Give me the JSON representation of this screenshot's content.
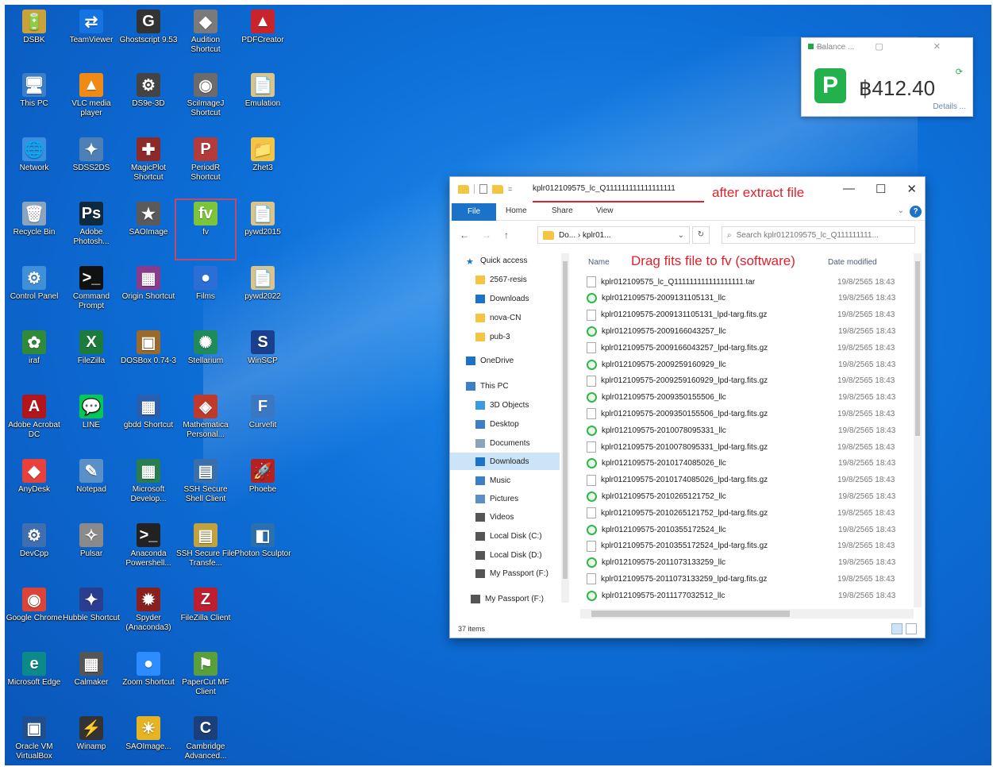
{
  "desktop": {
    "icons": [
      {
        "label": "DSBK",
        "glyph": "🔋",
        "color": "#caa23b"
      },
      {
        "label": "TeamViewer",
        "glyph": "⇄",
        "color": "#1674e2"
      },
      {
        "label": "Ghostscript 9.53",
        "glyph": "G",
        "color": "#333333"
      },
      {
        "label": "Audition Shortcut",
        "glyph": "◆",
        "color": "#7a7a7a"
      },
      {
        "label": "PDFCreator",
        "glyph": "▲",
        "color": "#c9232b"
      },
      {
        "label": "This PC",
        "glyph": "🖥",
        "color": "#3c7ec8"
      },
      {
        "label": "VLC media player",
        "glyph": "▲",
        "color": "#f08a16"
      },
      {
        "label": "DS9e-3D",
        "glyph": "⚙",
        "color": "#444444"
      },
      {
        "label": "SciImageJ Shortcut",
        "glyph": "◉",
        "color": "#6b6b6b"
      },
      {
        "label": "Emulation",
        "glyph": "📄",
        "color": "#d9c48c"
      },
      {
        "label": "Network",
        "glyph": "🌐",
        "color": "#3a8fe0"
      },
      {
        "label": "SDSS2DS",
        "glyph": "✦",
        "color": "#4e7fb6"
      },
      {
        "label": "MagicPlot Shortcut",
        "glyph": "✚",
        "color": "#8c2a2a"
      },
      {
        "label": "PeriodR Shortcut",
        "glyph": "P",
        "color": "#b33b3b"
      },
      {
        "label": "Zhet3",
        "glyph": "📁",
        "color": "#f4c542"
      },
      {
        "label": "Recycle Bin",
        "glyph": "🗑",
        "color": "#8aa4c0"
      },
      {
        "label": "Adobe Photosh...",
        "glyph": "Ps",
        "color": "#0f2a3f"
      },
      {
        "label": "SAOImage",
        "glyph": "★",
        "color": "#5a5a5a"
      },
      {
        "label": "fv",
        "glyph": "fv",
        "color": "#7cc43a"
      },
      {
        "label": "pywd2015",
        "glyph": "📄",
        "color": "#d9c48c"
      },
      {
        "label": "Control Panel",
        "glyph": "⚙",
        "color": "#3f8fd9"
      },
      {
        "label": "Command Prompt",
        "glyph": ">_",
        "color": "#111111"
      },
      {
        "label": "Origin Shortcut",
        "glyph": "▦",
        "color": "#8a3b8a"
      },
      {
        "label": "Films",
        "glyph": "●",
        "color": "#2b6fd6"
      },
      {
        "label": "pywd2022",
        "glyph": "📄",
        "color": "#d9c48c"
      },
      {
        "label": "iraf",
        "glyph": "✿",
        "color": "#2f8a3a"
      },
      {
        "label": "FileZilla",
        "glyph": "X",
        "color": "#1c7b3a"
      },
      {
        "label": "DOSBox 0.74-3",
        "glyph": "▣",
        "color": "#9b6a2a"
      },
      {
        "label": "Stellarium",
        "glyph": "✺",
        "color": "#1f8a5a"
      },
      {
        "label": "WinSCP",
        "glyph": "S",
        "color": "#1a3f8f"
      },
      {
        "label": "Adobe Acrobat DC",
        "glyph": "A",
        "color": "#b3151c"
      },
      {
        "label": "LINE",
        "glyph": "💬",
        "color": "#06c755"
      },
      {
        "label": "gbdd Shortcut",
        "glyph": "▦",
        "color": "#2a5fb0"
      },
      {
        "label": "Mathematica Personal...",
        "glyph": "◈",
        "color": "#c0392b"
      },
      {
        "label": "Curvefit",
        "glyph": "F",
        "color": "#3b78c4"
      },
      {
        "label": "AnyDesk",
        "glyph": "◆",
        "color": "#e8413c"
      },
      {
        "label": "Notepad",
        "glyph": "✎",
        "color": "#5a8fc8"
      },
      {
        "label": "Microsoft Develop...",
        "glyph": "▦",
        "color": "#2a7d4f"
      },
      {
        "label": "SSH Secure Shell Client",
        "glyph": "▤",
        "color": "#3a6fae"
      },
      {
        "label": "Phoebe",
        "glyph": "🚀",
        "color": "#b22222"
      },
      {
        "label": "DevCpp",
        "glyph": "⚙",
        "color": "#3f6fb0"
      },
      {
        "label": "Pulsar",
        "glyph": "✧",
        "color": "#8a8a8a"
      },
      {
        "label": "Anaconda Powershell...",
        "glyph": ">_",
        "color": "#222222"
      },
      {
        "label": "SSH Secure File Transfe...",
        "glyph": "▤",
        "color": "#c4a23b"
      },
      {
        "label": "Photon Sculptor",
        "glyph": "◧",
        "color": "#2a6fb0"
      },
      {
        "label": "Google Chrome",
        "glyph": "◉",
        "color": "#db4437"
      },
      {
        "label": "Hubble Shortcut",
        "glyph": "✦",
        "color": "#2b3d8f"
      },
      {
        "label": "Spyder (Anaconda3)",
        "glyph": "✹",
        "color": "#8a1f1f"
      },
      {
        "label": "FileZilla Client",
        "glyph": "Z",
        "color": "#bf1e2e"
      },
      {
        "label": "",
        "glyph": "",
        "color": "transparent"
      },
      {
        "label": "Microsoft Edge",
        "glyph": "e",
        "color": "#0c8a8a"
      },
      {
        "label": "Calmaker",
        "glyph": "▦",
        "color": "#555555"
      },
      {
        "label": "Zoom Shortcut",
        "glyph": "●",
        "color": "#2d8cff"
      },
      {
        "label": "PaperCut MF Client",
        "glyph": "⚑",
        "color": "#5aa03a"
      },
      {
        "label": "",
        "glyph": "",
        "color": "transparent"
      },
      {
        "label": "Oracle VM VirtualBox",
        "glyph": "▣",
        "color": "#1f4f8f"
      },
      {
        "label": "Winamp",
        "glyph": "⚡",
        "color": "#333333"
      },
      {
        "label": "SAOImage...",
        "glyph": "☀",
        "color": "#e6b422"
      },
      {
        "label": "Cambridge Advanced...",
        "glyph": "C",
        "color": "#1a3f7a"
      },
      {
        "label": "",
        "glyph": "",
        "color": "transparent"
      }
    ]
  },
  "balance_widget": {
    "title": "Balance ...",
    "controls": "— ▢ ✕",
    "amount": "฿412.40",
    "details": "Details ...",
    "sync": "⟳"
  },
  "explorer": {
    "title_path": "kplr012109575_lc_Q111111111111111111",
    "annotation_title": "after extract file",
    "win_min": "—",
    "win_max": "☐",
    "win_close": "✕",
    "tabs": {
      "file": "File",
      "home": "Home",
      "share": "Share",
      "view": "View"
    },
    "help": "?",
    "address": "Do... › kplr01...",
    "address_dropdown": "⌄",
    "refresh": "↻",
    "search_placeholder": "Search kplr012109575_lc_Q111111111...",
    "nav_back": "←",
    "nav_forward": "→",
    "nav_up": "↑",
    "nav_items": [
      {
        "label": "Quick access",
        "icon": "star",
        "color": "#1a73c8"
      },
      {
        "label": "2567-resis",
        "icon": "folder",
        "color": "#f4c542"
      },
      {
        "label": "Downloads",
        "icon": "download",
        "color": "#1a73c8"
      },
      {
        "label": "nova-CN",
        "icon": "folder",
        "color": "#f4c542"
      },
      {
        "label": "pub-3",
        "icon": "folder",
        "color": "#f4c542"
      },
      {
        "label": "OneDrive",
        "icon": "cloud",
        "color": "#1a73c8"
      },
      {
        "label": "This PC",
        "icon": "pc",
        "color": "#3c7ec8"
      },
      {
        "label": "3D Objects",
        "icon": "cube",
        "color": "#3c9ae0"
      },
      {
        "label": "Desktop",
        "icon": "desktop",
        "color": "#3c7ec8"
      },
      {
        "label": "Documents",
        "icon": "doc",
        "color": "#8aa4c0"
      },
      {
        "label": "Downloads",
        "icon": "download",
        "color": "#1a73c8"
      },
      {
        "label": "Music",
        "icon": "music",
        "color": "#3c7ec8"
      },
      {
        "label": "Pictures",
        "icon": "pic",
        "color": "#5a8fc8"
      },
      {
        "label": "Videos",
        "icon": "video",
        "color": "#555555"
      },
      {
        "label": "Local Disk (C:)",
        "icon": "disk",
        "color": "#555555"
      },
      {
        "label": "Local Disk (D:)",
        "icon": "disk",
        "color": "#555555"
      },
      {
        "label": "My Passport (F:)",
        "icon": "disk",
        "color": "#555555"
      },
      {
        "label": "My Passport (F:)",
        "icon": "disk",
        "color": "#555555"
      }
    ],
    "col_name": "Name",
    "annotation_drag": "Drag fits file to fv (software)",
    "col_date": "Date modified",
    "files": [
      {
        "name": "kplr012109575_lc_Q111111111111111111.tar",
        "type": "doc",
        "date": "19/8/2565 18:43"
      },
      {
        "name": "kplr012109575-2009131105131_llc",
        "type": "fits",
        "date": "19/8/2565 18:43"
      },
      {
        "name": "kplr012109575-2009131105131_lpd-targ.fits.gz",
        "type": "doc",
        "date": "19/8/2565 18:43"
      },
      {
        "name": "kplr012109575-2009166043257_llc",
        "type": "fits",
        "date": "19/8/2565 18:43"
      },
      {
        "name": "kplr012109575-2009166043257_lpd-targ.fits.gz",
        "type": "doc",
        "date": "19/8/2565 18:43"
      },
      {
        "name": "kplr012109575-2009259160929_llc",
        "type": "fits",
        "date": "19/8/2565 18:43"
      },
      {
        "name": "kplr012109575-2009259160929_lpd-targ.fits.gz",
        "type": "doc",
        "date": "19/8/2565 18:43"
      },
      {
        "name": "kplr012109575-2009350155506_llc",
        "type": "fits",
        "date": "19/8/2565 18:43"
      },
      {
        "name": "kplr012109575-2009350155506_lpd-targ.fits.gz",
        "type": "doc",
        "date": "19/8/2565 18:43"
      },
      {
        "name": "kplr012109575-2010078095331_llc",
        "type": "fits",
        "date": "19/8/2565 18:43"
      },
      {
        "name": "kplr012109575-2010078095331_lpd-targ.fits.gz",
        "type": "doc",
        "date": "19/8/2565 18:43"
      },
      {
        "name": "kplr012109575-2010174085026_llc",
        "type": "fits",
        "date": "19/8/2565 18:43"
      },
      {
        "name": "kplr012109575-2010174085026_lpd-targ.fits.gz",
        "type": "doc",
        "date": "19/8/2565 18:43"
      },
      {
        "name": "kplr012109575-2010265121752_llc",
        "type": "fits",
        "date": "19/8/2565 18:43"
      },
      {
        "name": "kplr012109575-2010265121752_lpd-targ.fits.gz",
        "type": "doc",
        "date": "19/8/2565 18:43"
      },
      {
        "name": "kplr012109575-2010355172524_llc",
        "type": "fits",
        "date": "19/8/2565 18:43"
      },
      {
        "name": "kplr012109575-2010355172524_lpd-targ.fits.gz",
        "type": "doc",
        "date": "19/8/2565 18:43"
      },
      {
        "name": "kplr012109575-2011073133259_llc",
        "type": "fits",
        "date": "19/8/2565 18:43"
      },
      {
        "name": "kplr012109575-2011073133259_lpd-targ.fits.gz",
        "type": "doc",
        "date": "19/8/2565 18:43"
      },
      {
        "name": "kplr012109575-2011177032512_llc",
        "type": "fits",
        "date": "19/8/2565 18:43"
      }
    ],
    "status": "37 items"
  }
}
